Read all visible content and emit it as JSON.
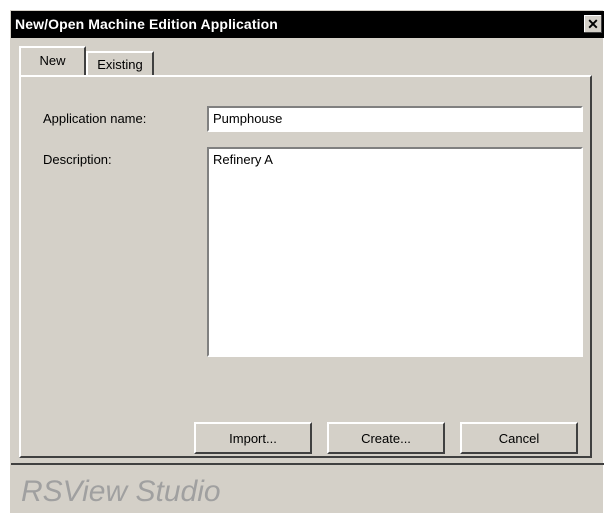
{
  "window": {
    "title": "New/Open Machine Edition Application",
    "close_glyph": "✕"
  },
  "tabs": [
    {
      "label": "New",
      "active": true
    },
    {
      "label": "Existing",
      "active": false
    }
  ],
  "form": {
    "app_name_label": "Application name:",
    "app_name_value": "Pumphouse",
    "description_label": "Description:",
    "description_value": "Refinery A"
  },
  "buttons": {
    "import": "Import...",
    "create": "Create...",
    "cancel": "Cancel"
  },
  "footer": {
    "brand": "RSView Studio"
  }
}
